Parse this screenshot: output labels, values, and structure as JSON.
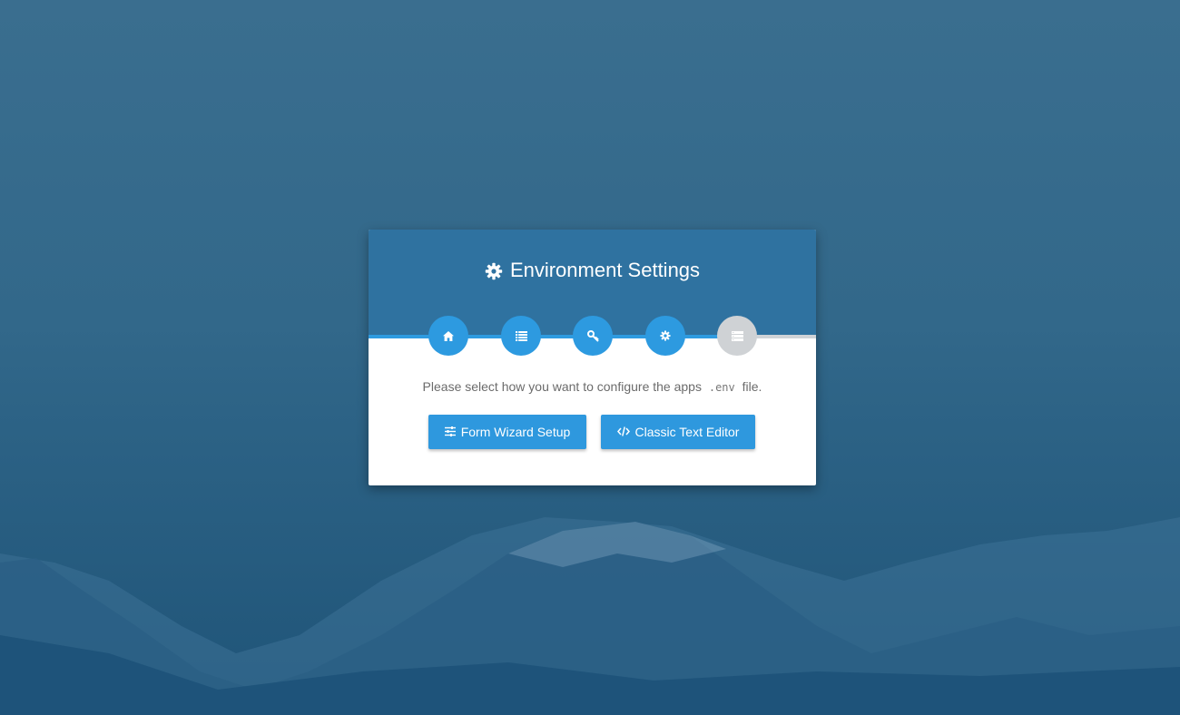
{
  "header": {
    "title": "Environment Settings",
    "title_icon": "gear-icon"
  },
  "steps": [
    {
      "icon": "home-icon",
      "state": "active"
    },
    {
      "icon": "list-icon",
      "state": "active"
    },
    {
      "icon": "key-icon",
      "state": "active"
    },
    {
      "icon": "gear-icon",
      "state": "active"
    },
    {
      "icon": "server-icon",
      "state": "inactive"
    }
  ],
  "message": {
    "before": "Please select how you want to configure the apps",
    "code": ".env",
    "after": "file."
  },
  "buttons": {
    "wizard_label": "Form Wizard Setup",
    "wizard_icon": "sliders-icon",
    "editor_label": "Classic Text Editor",
    "editor_icon": "code-icon"
  },
  "colors": {
    "header": "#2f72a0",
    "accent": "#2e98de",
    "inactive": "#cfd2d5"
  }
}
